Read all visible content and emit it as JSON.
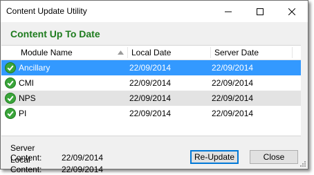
{
  "window": {
    "title": "Content Update Utility"
  },
  "heading": "Content Up To Date",
  "colors": {
    "heading": "#1d7b1d",
    "selection": "#3399ff",
    "check_icon": "#3aa53a"
  },
  "columns": {
    "module": "Module Name",
    "local": "Local Date",
    "server": "Server Date"
  },
  "rows": [
    {
      "module": "Ancillary",
      "local": "22/09/2014",
      "server": "22/09/2014",
      "status_icon": "check-circle-icon",
      "selected": true
    },
    {
      "module": "CMI",
      "local": "22/09/2014",
      "server": "22/09/2014",
      "status_icon": "check-circle-icon",
      "selected": false
    },
    {
      "module": "NPS",
      "local": "22/09/2014",
      "server": "22/09/2014",
      "status_icon": "check-circle-icon",
      "selected": false
    },
    {
      "module": "PI",
      "local": "22/09/2014",
      "server": "22/09/2014",
      "status_icon": "check-circle-icon",
      "selected": false
    }
  ],
  "status": {
    "server_label": "Server Content:",
    "server_value": "22/09/2014",
    "local_label": "Local Content:",
    "local_value": "22/09/2014"
  },
  "buttons": {
    "reupdate": "Re-Update",
    "close": "Close"
  }
}
